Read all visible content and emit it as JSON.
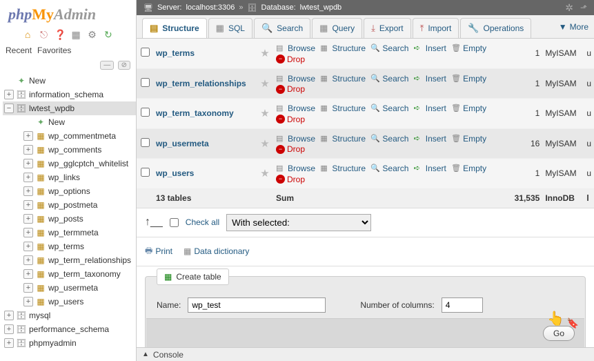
{
  "logo": {
    "php": "php",
    "my": "My",
    "admin": "Admin"
  },
  "side_tabs": {
    "recent": "Recent",
    "favorites": "Favorites"
  },
  "tree": {
    "new": "New",
    "dbs": [
      {
        "name": "information_schema"
      },
      {
        "name": "lwtest_wpdb",
        "expanded": true,
        "children": [
          {
            "name": "New",
            "new": true
          },
          {
            "name": "wp_commentmeta"
          },
          {
            "name": "wp_comments"
          },
          {
            "name": "wp_gglcptch_whitelist"
          },
          {
            "name": "wp_links"
          },
          {
            "name": "wp_options"
          },
          {
            "name": "wp_postmeta"
          },
          {
            "name": "wp_posts"
          },
          {
            "name": "wp_termmeta"
          },
          {
            "name": "wp_terms"
          },
          {
            "name": "wp_term_relationships"
          },
          {
            "name": "wp_term_taxonomy"
          },
          {
            "name": "wp_usermeta"
          },
          {
            "name": "wp_users"
          }
        ]
      },
      {
        "name": "mysql"
      },
      {
        "name": "performance_schema"
      },
      {
        "name": "phpmyadmin"
      }
    ]
  },
  "breadcrumb": {
    "server_label": "Server:",
    "server": "localhost:3306",
    "db_label": "Database:",
    "db": "lwtest_wpdb"
  },
  "tabs": {
    "structure": "Structure",
    "sql": "SQL",
    "search": "Search",
    "query": "Query",
    "export": "Export",
    "import": "Import",
    "operations": "Operations",
    "more": "More"
  },
  "actions": {
    "browse": "Browse",
    "structure": "Structure",
    "search": "Search",
    "insert": "Insert",
    "empty": "Empty",
    "drop": "Drop"
  },
  "rows": [
    {
      "name": "wp_terms",
      "count": "1",
      "engine": "MyISAM"
    },
    {
      "name": "wp_term_relationships",
      "count": "1",
      "engine": "MyISAM"
    },
    {
      "name": "wp_term_taxonomy",
      "count": "1",
      "engine": "MyISAM"
    },
    {
      "name": "wp_usermeta",
      "count": "16",
      "engine": "MyISAM"
    },
    {
      "name": "wp_users",
      "count": "1",
      "engine": "MyISAM"
    }
  ],
  "summary": {
    "count_label": "13 tables",
    "sum_label": "Sum",
    "total": "31,535",
    "engine": "InnoDB"
  },
  "check_all": {
    "label": "Check all",
    "dropdown": "With selected:"
  },
  "util": {
    "print": "Print",
    "dict": "Data dictionary"
  },
  "create": {
    "legend": "Create table",
    "name_label": "Name:",
    "name_value": "wp_test",
    "cols_label": "Number of columns:",
    "cols_value": "4",
    "go": "Go"
  },
  "console": "Console"
}
